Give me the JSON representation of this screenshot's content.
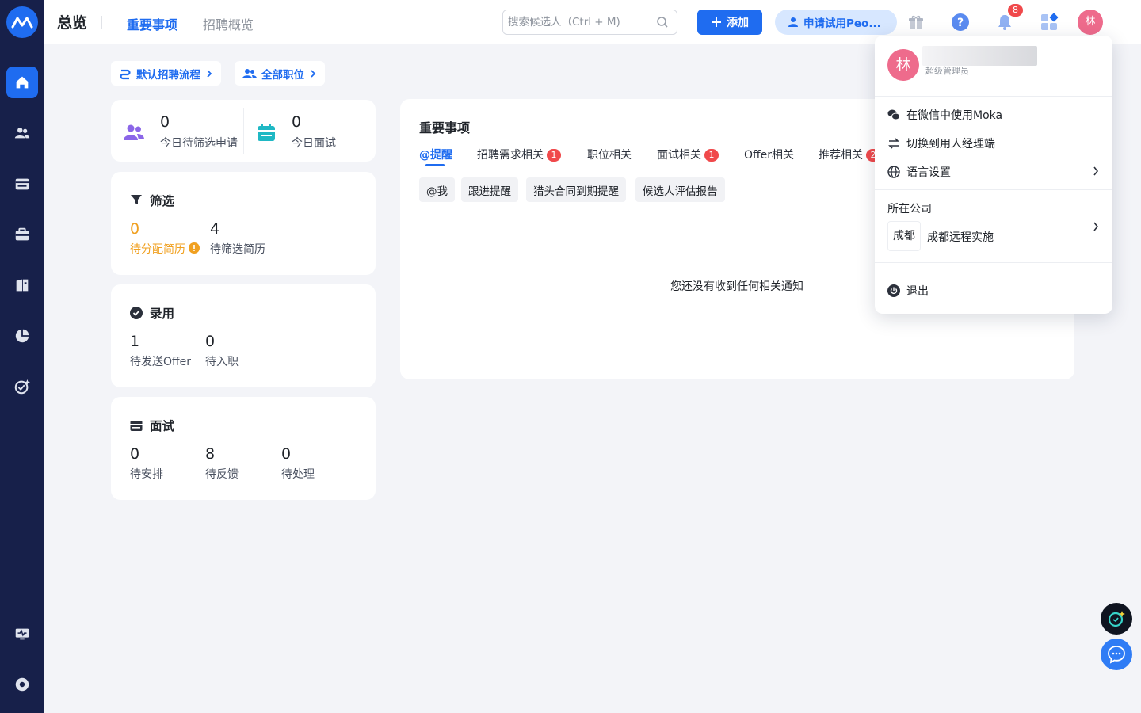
{
  "header": {
    "title": "总览",
    "tabs": [
      {
        "label": "重要事项",
        "active": true
      },
      {
        "label": "招聘概览",
        "active": false
      }
    ],
    "search_placeholder": "搜索候选人（Ctrl + M)",
    "add_label": "添加",
    "trial_label": "申请试用Peo...",
    "notification_count": "8",
    "avatar_text": "林"
  },
  "chips": [
    {
      "label": "默认招聘流程"
    },
    {
      "label": "全部职位"
    }
  ],
  "today": {
    "screen": {
      "value": "0",
      "label": "今日待筛选申请"
    },
    "interview": {
      "value": "0",
      "label": "今日面试"
    }
  },
  "screening": {
    "title": "筛选",
    "stats": [
      {
        "value": "0",
        "label": "待分配简历"
      },
      {
        "value": "4",
        "label": "待筛选简历"
      }
    ]
  },
  "hiring": {
    "title": "录用",
    "stats": [
      {
        "value": "1",
        "label": "待发送Offer"
      },
      {
        "value": "0",
        "label": "待入职"
      }
    ]
  },
  "interviews": {
    "title": "面试",
    "stats": [
      {
        "value": "0",
        "label": "待安排"
      },
      {
        "value": "8",
        "label": "待反馈"
      },
      {
        "value": "0",
        "label": "待处理"
      }
    ]
  },
  "important": {
    "title": "重要事项",
    "tabs": [
      {
        "label": "@提醒",
        "badge": ""
      },
      {
        "label": "招聘需求相关",
        "badge": "1"
      },
      {
        "label": "职位相关",
        "badge": ""
      },
      {
        "label": "面试相关",
        "badge": "1"
      },
      {
        "label": "Offer相关",
        "badge": ""
      },
      {
        "label": "推荐相关",
        "badge": "2"
      }
    ],
    "subtabs": [
      "@我",
      "跟进提醒",
      "猎头合同到期提醒",
      "候选人评估报告"
    ],
    "empty_text": "您还没有收到任何相关通知"
  },
  "dropdown": {
    "avatar_text": "林",
    "role": "超级管理员",
    "items": [
      {
        "label": "在微信中使用Moka"
      },
      {
        "label": "切换到用人经理端"
      },
      {
        "label": "语言设置"
      }
    ],
    "company_heading": "所在公司",
    "company_tag": "成都",
    "company_name": "成都远程实施",
    "logout_label": "退出"
  },
  "colors": {
    "primary": "#1f6cf0",
    "sidebar": "#17204a",
    "badge": "#f0494b",
    "warning": "#f0a020",
    "avatar": "#ee6b8c"
  }
}
